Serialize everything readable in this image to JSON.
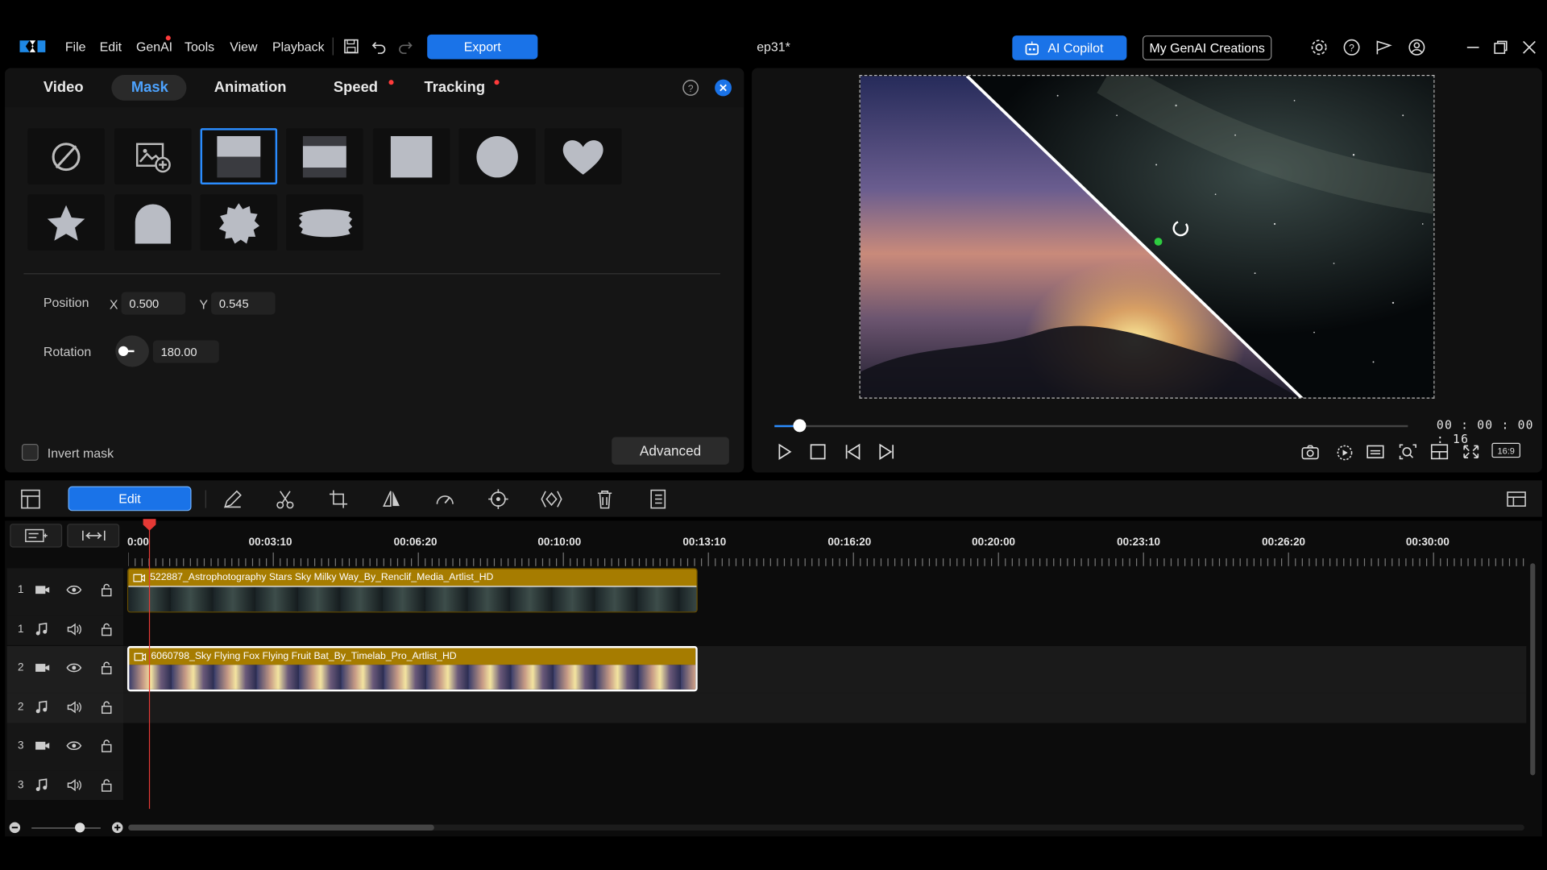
{
  "app": {
    "menu": [
      "File",
      "Edit",
      "GenAI",
      "Tools",
      "View",
      "Playback"
    ],
    "export_label": "Export",
    "project_title": "ep31*",
    "copilot_label": "AI Copilot",
    "genai_creations_label": "My GenAI Creations"
  },
  "mask_panel": {
    "tabs": [
      "Video",
      "Mask",
      "Animation",
      "Speed",
      "Tracking"
    ],
    "active_tab": "Mask",
    "position_label": "Position",
    "x_label": "X",
    "x_value": "0.500",
    "y_label": "Y",
    "y_value": "0.545",
    "rotation_label": "Rotation",
    "rotation_value": "180.00",
    "invert_label": "Invert mask",
    "advanced_label": "Advanced",
    "masks": [
      "no-mask",
      "image-mask",
      "half-mask",
      "band-mask",
      "square-mask",
      "circle-mask",
      "heart-mask",
      "star-mask",
      "arch-mask",
      "burst-mask",
      "brush-mask"
    ],
    "selected_mask": "half-mask"
  },
  "preview": {
    "timecode": "00 : 00 : 00 : 16",
    "progress": 0.04,
    "aspect_label": "16:9"
  },
  "toolbar": {
    "edit_label": "Edit"
  },
  "timeline": {
    "ruler": [
      "0:00",
      "00:03:10",
      "00:06:20",
      "00:10:00",
      "00:13:10",
      "00:16:20",
      "00:20:00",
      "00:23:10",
      "00:26:20",
      "00:30:00"
    ],
    "tracks": [
      {
        "num": "1",
        "type": "video"
      },
      {
        "num": "1",
        "type": "audio"
      },
      {
        "num": "2",
        "type": "video"
      },
      {
        "num": "2",
        "type": "audio"
      },
      {
        "num": "3",
        "type": "video"
      },
      {
        "num": "3",
        "type": "audio"
      }
    ],
    "clips": [
      {
        "title": "522887_Astrophotography Stars Sky Milky Way_By_Renclif_Media_Artlist_HD"
      },
      {
        "title": "6060798_Sky Flying Fox Flying Fruit Bat_By_Timelab_Pro_Artlist_HD"
      }
    ]
  },
  "colors": {
    "accent": "#1a73e8",
    "clip_title": "#a67c00",
    "playhead": "#e53935"
  }
}
